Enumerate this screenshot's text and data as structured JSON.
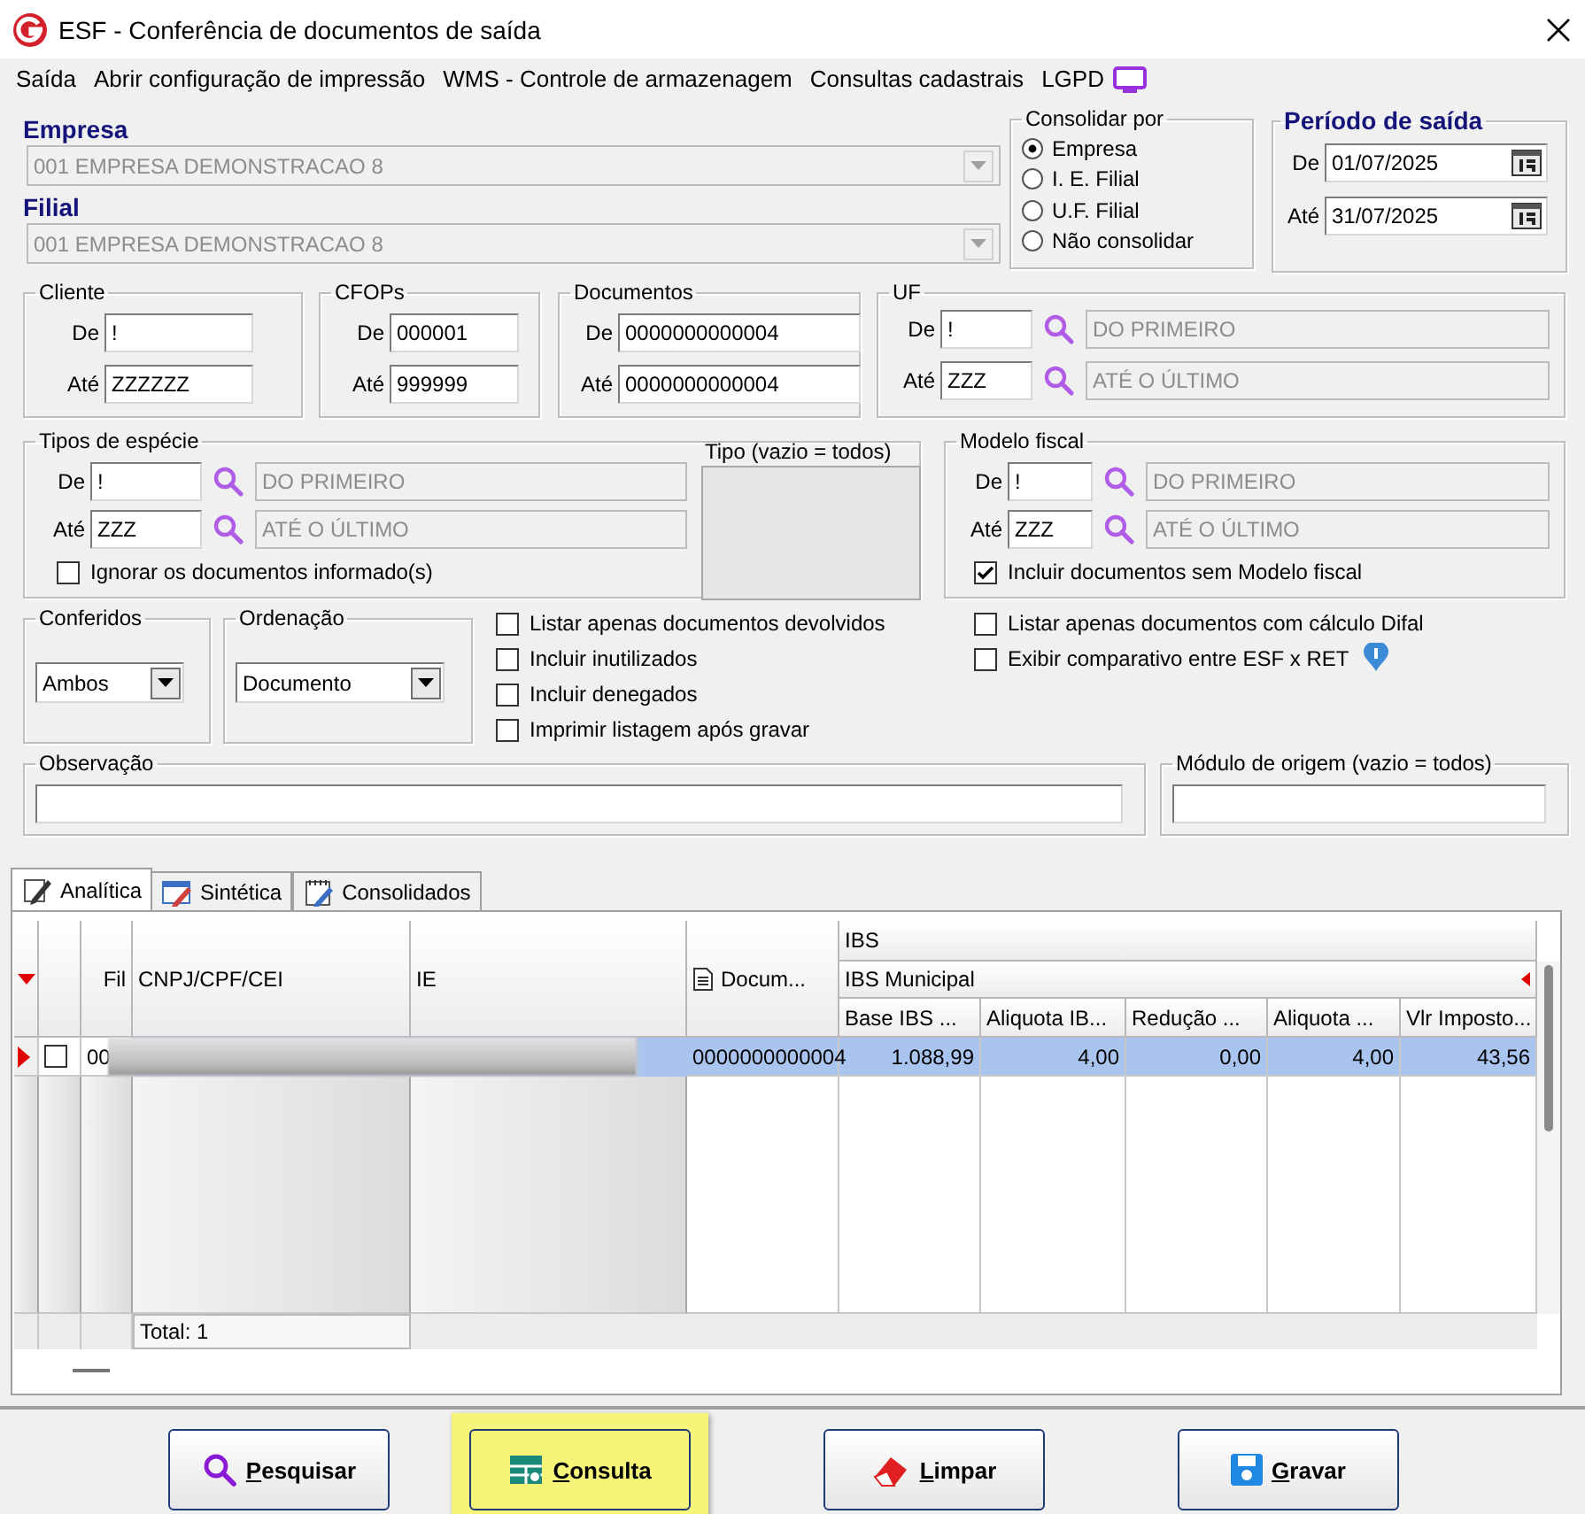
{
  "window": {
    "title": "ESF - Conferência de documentos de saída"
  },
  "menu": [
    {
      "label": "Saída"
    },
    {
      "label": "Abrir configuração de impressão"
    },
    {
      "label": "WMS - Controle de armazenagem"
    },
    {
      "label": "Consultas cadastrais"
    },
    {
      "label": "LGPD"
    }
  ],
  "empresa": {
    "label": "Empresa",
    "value": "001 EMPRESA DEMONSTRACAO 8",
    "disabled": true
  },
  "filial": {
    "label": "Filial",
    "value": "001 EMPRESA DEMONSTRACAO 8",
    "disabled": true
  },
  "consolidar": {
    "title": "Consolidar por",
    "options": [
      {
        "label": "Empresa",
        "selected": true
      },
      {
        "label": "I. E. Filial",
        "selected": false
      },
      {
        "label": "U.F. Filial",
        "selected": false
      },
      {
        "label": "Não consolidar",
        "selected": false
      }
    ]
  },
  "periodo": {
    "title": "Período de saída",
    "rows": [
      {
        "label": "De",
        "value": "01/07/2025"
      },
      {
        "label": "Até",
        "value": "31/07/2025"
      }
    ]
  },
  "cliente": {
    "title": "Cliente",
    "rows": [
      {
        "label": "De",
        "value": "!"
      },
      {
        "label": "Até",
        "value": "ZZZZZZ"
      }
    ]
  },
  "cfops": {
    "title": "CFOPs",
    "rows": [
      {
        "label": "De",
        "value": "000001"
      },
      {
        "label": "Até",
        "value": "999999"
      }
    ]
  },
  "documentos": {
    "title": "Documentos",
    "rows": [
      {
        "label": "De",
        "value": "0000000000004"
      },
      {
        "label": "Até",
        "value": "0000000000004"
      }
    ]
  },
  "uf": {
    "title": "UF",
    "rows": [
      {
        "label": "De",
        "value": "!",
        "description": "DO PRIMEIRO"
      },
      {
        "label": "Até",
        "value": "ZZZ",
        "description": "ATÉ O ÚLTIMO"
      }
    ]
  },
  "tipos_especie": {
    "title": "Tipos de espécie",
    "rows": [
      {
        "label": "De",
        "value": "!",
        "description": "DO PRIMEIRO"
      },
      {
        "label": "Até",
        "value": "ZZZ",
        "description": "ATÉ O ÚLTIMO"
      }
    ],
    "option": {
      "label": "Ignorar os documentos informado(s)",
      "checked": false
    },
    "tipo": {
      "title": "Tipo (vazio = todos)"
    }
  },
  "modelo_fiscal": {
    "title": "Modelo fiscal",
    "rows": [
      {
        "label": "De",
        "value": "!",
        "description": "DO PRIMEIRO"
      },
      {
        "label": "Até",
        "value": "ZZZ",
        "description": "ATÉ O ÚLTIMO"
      }
    ],
    "option": {
      "label": "Incluir documentos sem Modelo fiscal",
      "checked": true
    }
  },
  "conferidos": {
    "title": "Conferidos",
    "value": "Ambos"
  },
  "ordenacao": {
    "title": "Ordenação",
    "value": "Documento"
  },
  "options_left": [
    {
      "label": "Listar apenas documentos devolvidos",
      "checked": false
    },
    {
      "label": "Incluir inutilizados",
      "checked": false
    },
    {
      "label": "Incluir denegados",
      "checked": false
    },
    {
      "label": "Imprimir listagem após gravar",
      "checked": false
    }
  ],
  "options_right": [
    {
      "label": "Listar apenas documentos com cálculo Difal",
      "checked": false
    },
    {
      "label": "Exibir comparativo entre ESF x  RET",
      "checked": false
    }
  ],
  "observacao": {
    "title": "Observação"
  },
  "modulo_origem": {
    "title": "Módulo de origem (vazio = todos)"
  },
  "tabs": [
    {
      "label": "Analítica",
      "selected": true
    },
    {
      "label": "Sintética",
      "selected": false
    },
    {
      "label": "Consolidados",
      "selected": false
    }
  ],
  "grid": {
    "group_header": "IBS",
    "subgroup_header": "IBS Municipal",
    "columns": [
      "Fil",
      "CNPJ/CPF/CEI",
      "IE",
      "Docum..."
    ],
    "value_columns": [
      "Base IBS ...",
      "Aliquota IB...",
      "Redução ...",
      "Aliquota ...",
      "Vlr Imposto..."
    ],
    "rows": [
      {
        "selected": true,
        "checked": false,
        "fil": "00",
        "documento": "0000000000004",
        "values": [
          "1.088,99",
          "4,00",
          "0,00",
          "4,00",
          "43,56"
        ]
      }
    ],
    "total": "Total: 1"
  },
  "buttons": [
    {
      "label": "Pesquisar",
      "kind": "search",
      "highlighted": false
    },
    {
      "label": "Consulta",
      "kind": "grid",
      "highlighted": true
    },
    {
      "label": "Limpar",
      "kind": "eraser",
      "highlighted": false
    },
    {
      "label": "Gravar",
      "kind": "save",
      "highlighted": false
    }
  ]
}
